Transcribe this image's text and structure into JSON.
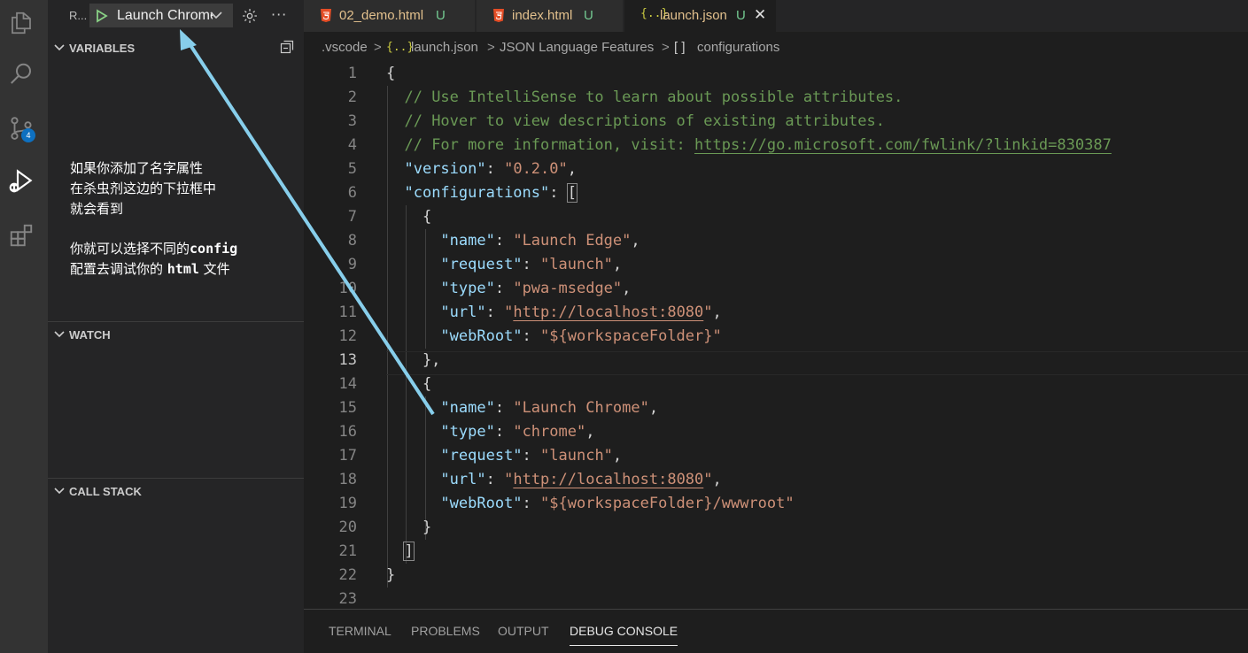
{
  "activity_bar": {
    "items": [
      {
        "icon": "explorer-icon"
      },
      {
        "icon": "search-icon"
      },
      {
        "icon": "source-control-icon",
        "badge": "4"
      },
      {
        "icon": "run-debug-icon",
        "active": true
      },
      {
        "icon": "extensions-icon"
      }
    ]
  },
  "debug_toolbar": {
    "run_label": "R...",
    "launch_config": "Launch Chrome",
    "more": "···"
  },
  "sections": {
    "variables": "VARIABLES",
    "watch": "WATCH",
    "call_stack": "CALL STACK"
  },
  "annotation": {
    "line1": "如果你添加了名字属性",
    "line2": "在杀虫剂这边的下拉框中",
    "line3": "就会看到",
    "line4a": "你就可以选择不同的",
    "line4b": "config",
    "line5a": "配置去调试你的 ",
    "line5b": "html",
    "line5c": " 文件",
    "arrow_color": "#87ceeb"
  },
  "tabs": [
    {
      "name": "02_demo.html",
      "status": "U",
      "icon": "html5-icon"
    },
    {
      "name": "index.html",
      "status": "U",
      "icon": "html5-icon"
    },
    {
      "name": "launch.json",
      "status": "U",
      "icon": "json-icon",
      "active": true,
      "close": "✕"
    }
  ],
  "breadcrumb": {
    "folder": ".vscode",
    "file": "launch.json",
    "features": "JSON Language Features",
    "symbol": "configurations",
    "json_glyph": "{..}",
    "array_glyph": "[ ]",
    "sep": ">"
  },
  "editor": {
    "current_line": 13,
    "lines": [
      {
        "n": "1",
        "p": [
          "{"
        ]
      },
      {
        "n": "2",
        "p": [
          "  ",
          "// Use IntelliSense to learn about possible attributes."
        ]
      },
      {
        "n": "3",
        "p": [
          "  ",
          "// Hover to view descriptions of existing attributes."
        ]
      },
      {
        "n": "4",
        "p": [
          "  ",
          "// For more information, visit: ",
          "https://go.microsoft.com/fwlink/?linkid=830387"
        ]
      },
      {
        "n": "5",
        "p": [
          "  ",
          "\"version\"",
          ": ",
          "\"0.2.0\"",
          ","
        ]
      },
      {
        "n": "6",
        "p": [
          "  ",
          "\"configurations\"",
          ": ",
          "["
        ]
      },
      {
        "n": "7",
        "p": [
          "    {"
        ]
      },
      {
        "n": "8",
        "p": [
          "      ",
          "\"name\"",
          ": ",
          "\"Launch Edge\"",
          ","
        ]
      },
      {
        "n": "9",
        "p": [
          "      ",
          "\"request\"",
          ": ",
          "\"launch\"",
          ","
        ]
      },
      {
        "n": "10",
        "p": [
          "      ",
          "\"type\"",
          ": ",
          "\"pwa-msedge\"",
          ","
        ]
      },
      {
        "n": "11",
        "p": [
          "      ",
          "\"url\"",
          ": ",
          "\"",
          "http://localhost:8080",
          "\"",
          ","
        ]
      },
      {
        "n": "12",
        "p": [
          "      ",
          "\"webRoot\"",
          ": ",
          "\"${workspaceFolder}\""
        ]
      },
      {
        "n": "13",
        "p": [
          "    },"
        ]
      },
      {
        "n": "14",
        "p": [
          "    {"
        ]
      },
      {
        "n": "15",
        "p": [
          "      ",
          "\"name\"",
          ": ",
          "\"Launch Chrome\"",
          ","
        ]
      },
      {
        "n": "16",
        "p": [
          "      ",
          "\"type\"",
          ": ",
          "\"chrome\"",
          ","
        ]
      },
      {
        "n": "17",
        "p": [
          "      ",
          "\"request\"",
          ": ",
          "\"launch\"",
          ","
        ]
      },
      {
        "n": "18",
        "p": [
          "      ",
          "\"url\"",
          ": ",
          "\"",
          "http://localhost:8080",
          "\"",
          ","
        ]
      },
      {
        "n": "19",
        "p": [
          "      ",
          "\"webRoot\"",
          ": ",
          "\"${workspaceFolder}/wwwroot\""
        ]
      },
      {
        "n": "20",
        "p": [
          "    }"
        ]
      },
      {
        "n": "21",
        "p": [
          "  ",
          "]"
        ]
      },
      {
        "n": "22",
        "p": [
          "}"
        ]
      },
      {
        "n": "23",
        "p": [
          ""
        ]
      }
    ]
  },
  "panel_tabs": [
    "TERMINAL",
    "PROBLEMS",
    "OUTPUT",
    "DEBUG CONSOLE"
  ],
  "colors": {
    "comment": "#6a9955",
    "key": "#9cdcfe",
    "string": "#ce9178",
    "modified": "#e2c08d",
    "untracked": "#73c991",
    "accent": "#0e70c0"
  }
}
